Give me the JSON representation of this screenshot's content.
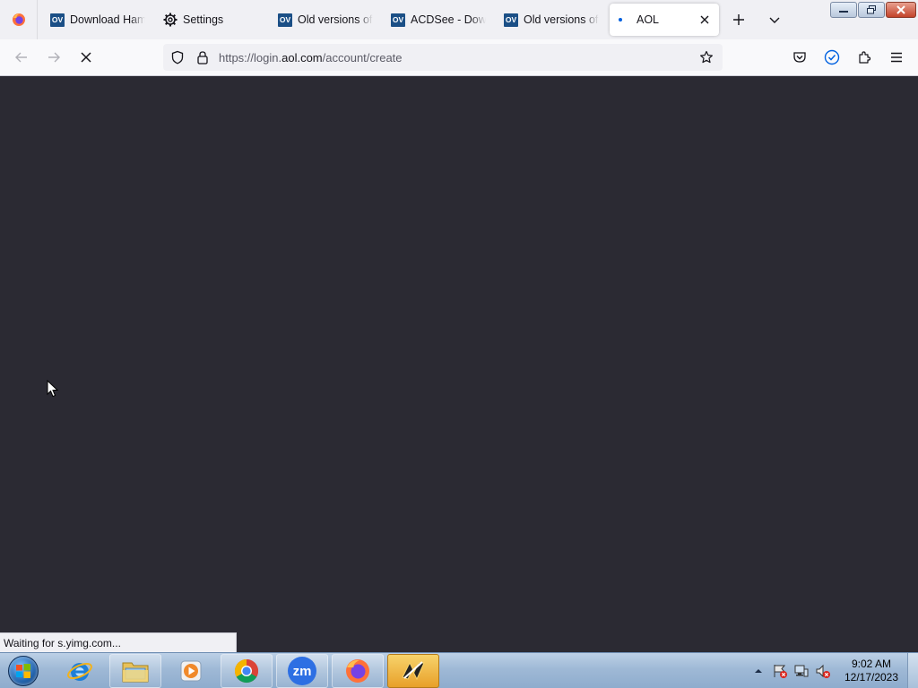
{
  "browser": {
    "tabs": [
      {
        "label": "Download Ham",
        "favicon": "ov-icon",
        "favicon_text": "OV",
        "active": false
      },
      {
        "label": "Settings",
        "favicon": "gear-icon",
        "active": false
      },
      {
        "label": "Old versions of",
        "favicon": "ov-icon",
        "favicon_text": "OV",
        "active": false
      },
      {
        "label": "ACDSee - Down",
        "favicon": "ov-icon",
        "favicon_text": "OV",
        "active": false
      },
      {
        "label": "Old versions of",
        "favicon": "ov-icon",
        "favicon_text": "OV",
        "active": false
      },
      {
        "label": "AOL",
        "favicon": "loading-dot-icon",
        "active": true
      }
    ],
    "url": {
      "prefix": "https://login.",
      "host": "aol.com",
      "path": "/account/create"
    },
    "status_text": "Waiting for s.yimg.com...",
    "content_background": "#2b2a33",
    "accent": "#0061e0"
  },
  "taskbar": {
    "apps": [
      {
        "name": "internet-explorer-icon"
      },
      {
        "name": "file-explorer-icon"
      },
      {
        "name": "media-player-icon"
      },
      {
        "name": "chrome-icon"
      },
      {
        "name": "zoom-icon",
        "text": "zm"
      },
      {
        "name": "firefox-icon"
      },
      {
        "name": "winamp-icon"
      }
    ],
    "clock": {
      "time": "9:02 AM",
      "date": "12/17/2023"
    }
  }
}
